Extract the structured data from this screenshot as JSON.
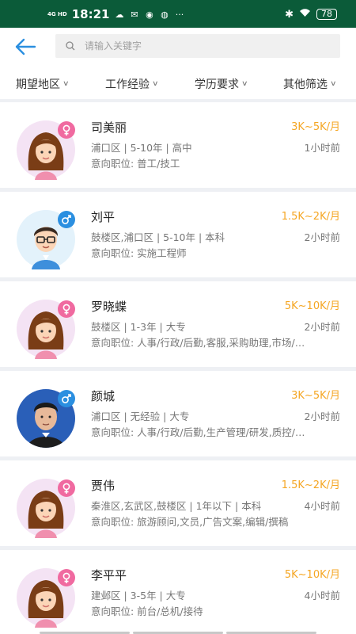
{
  "status_bar": {
    "network": "4G HD",
    "time": "18:21",
    "battery": "78"
  },
  "header": {
    "search_placeholder": "请输入关键字"
  },
  "filters": [
    {
      "label": "期望地区"
    },
    {
      "label": "工作经验"
    },
    {
      "label": "学历要求"
    },
    {
      "label": "其他筛选"
    }
  ],
  "candidates": [
    {
      "name": "司美丽",
      "gender": "female",
      "salary": "3K~5K/月",
      "meta": "浦口区 | 5-10年 | 高中",
      "time": "1小时前",
      "intent": "意向职位:  普工/技工"
    },
    {
      "name": "刘平",
      "gender": "male",
      "salary": "1.5K~2K/月",
      "meta": "鼓楼区,浦口区 | 5-10年 | 本科",
      "time": "2小时前",
      "intent": "意向职位:  实施工程师"
    },
    {
      "name": "罗晓蝶",
      "gender": "female",
      "salary": "5K~10K/月",
      "meta": "鼓楼区 | 1-3年 | 大专",
      "time": "2小时前",
      "intent": "意向职位:  人事/行政/后勤,客服,采购助理,市场/…"
    },
    {
      "name": "颜城",
      "gender": "male",
      "salary": "3K~5K/月",
      "meta": "浦口区 | 无经验 | 大专",
      "time": "2小时前",
      "intent": "意向职位:  人事/行政/后勤,生产管理/研发,质控/…"
    },
    {
      "name": "贾伟",
      "gender": "female",
      "salary": "1.5K~2K/月",
      "meta": "秦淮区,玄武区,鼓楼区 | 1年以下 | 本科",
      "time": "4小时前",
      "intent": "意向职位:  旅游顾问,文员,广告文案,编辑/撰稿"
    },
    {
      "name": "李平平",
      "gender": "female",
      "salary": "5K~10K/月",
      "meta": "建邺区 | 3-5年 | 大专",
      "time": "4小时前",
      "intent": "意向职位:  前台/总机/接待"
    }
  ],
  "colors": {
    "status_bar": "#0b5b39",
    "accent_blue": "#2b8fe0",
    "salary": "#f5a623",
    "female_badge": "#f06aa0",
    "male_badge": "#2b8fe0"
  }
}
